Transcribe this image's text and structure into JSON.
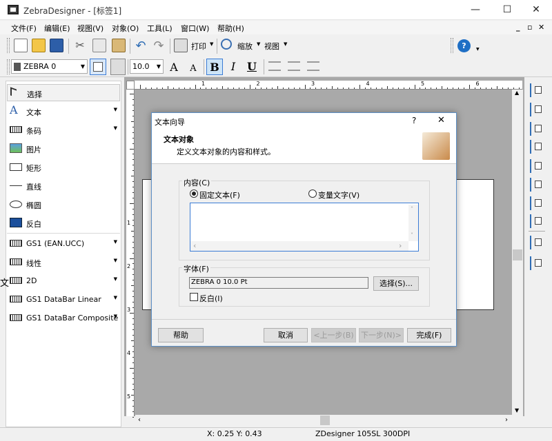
{
  "window": {
    "title": "ZebraDesigner - [标签1]",
    "minimize": "—",
    "maximize": "☐",
    "close": "✕"
  },
  "menu": {
    "items": [
      "文件(F)",
      "编辑(E)",
      "视图(V)",
      "对象(O)",
      "工具(L)",
      "窗口(W)",
      "帮助(H)"
    ],
    "mdi_min": "_",
    "mdi_restore": "▫",
    "mdi_close": "✕"
  },
  "toolbar": {
    "print_label": "打印",
    "zoom_label": "缩放",
    "view_label": "视图",
    "help_icon": "?"
  },
  "format_bar": {
    "printer_font": "ZEBRA 0",
    "font_size": "10.0",
    "bold": "B",
    "italic": "I",
    "underline": "U",
    "grow": "A",
    "shrink": "A"
  },
  "sidebar": {
    "items": [
      {
        "label": "选择",
        "icon": "pointer-icon",
        "selected": true,
        "arrow": false
      },
      {
        "label": "文本",
        "icon": "text-a-icon",
        "arrow": true
      },
      {
        "label": "条码",
        "icon": "barcode-icon",
        "arrow": true
      },
      {
        "label": "图片",
        "icon": "picture-icon",
        "arrow": false
      },
      {
        "label": "矩形",
        "icon": "rectangle-icon",
        "arrow": false
      },
      {
        "label": "直线",
        "icon": "line-icon",
        "arrow": false
      },
      {
        "label": "椭圆",
        "icon": "ellipse-icon",
        "arrow": false
      },
      {
        "label": "反白",
        "icon": "inverse-icon",
        "arrow": false
      },
      {
        "label": "GS1 (EAN.UCC)",
        "icon": "barcode-icon",
        "arrow": true
      },
      {
        "label": "线性",
        "icon": "barcode-icon",
        "arrow": true
      },
      {
        "label": "2D",
        "icon": "barcode-icon",
        "arrow": true
      },
      {
        "label": "GS1 DataBar Linear",
        "icon": "barcode-icon",
        "arrow": true
      },
      {
        "label": "GS1 DataBar Composite",
        "icon": "barcode-icon",
        "arrow": true
      }
    ]
  },
  "ruler": {
    "h_ticks": [
      "1",
      "2",
      "3",
      "4",
      "5",
      "6",
      "7"
    ],
    "v_ticks": [
      "1",
      "2",
      "3",
      "4",
      "5"
    ]
  },
  "dialog": {
    "title": "文本向导",
    "help": "?",
    "close": "✕",
    "heading": "文本对象",
    "subheading": "定义文本对象的内容和样式。",
    "content_group": "内容(C)",
    "radio_fixed": "固定文本(F)",
    "radio_variable": "变量文字(V)",
    "text_value": "",
    "font_group": "字体(F)",
    "font_value": "ZEBRA 0 10.0 Pt",
    "select_button": "选择(S)...",
    "inverse_checkbox": "反白(I)",
    "buttons": {
      "help": "帮助",
      "cancel": "取消",
      "prev": "<上一步(B)",
      "next": "下一步(N)>",
      "finish": "完成(F)"
    }
  },
  "status": {
    "coords": "X:  0.25 Y:   0.43",
    "printer": "ZDesigner 105SL 300DPI"
  },
  "colors": {
    "accent": "#0078d7",
    "canvas": "#a9a9a9",
    "dialog_border": "#5c8fc6"
  }
}
